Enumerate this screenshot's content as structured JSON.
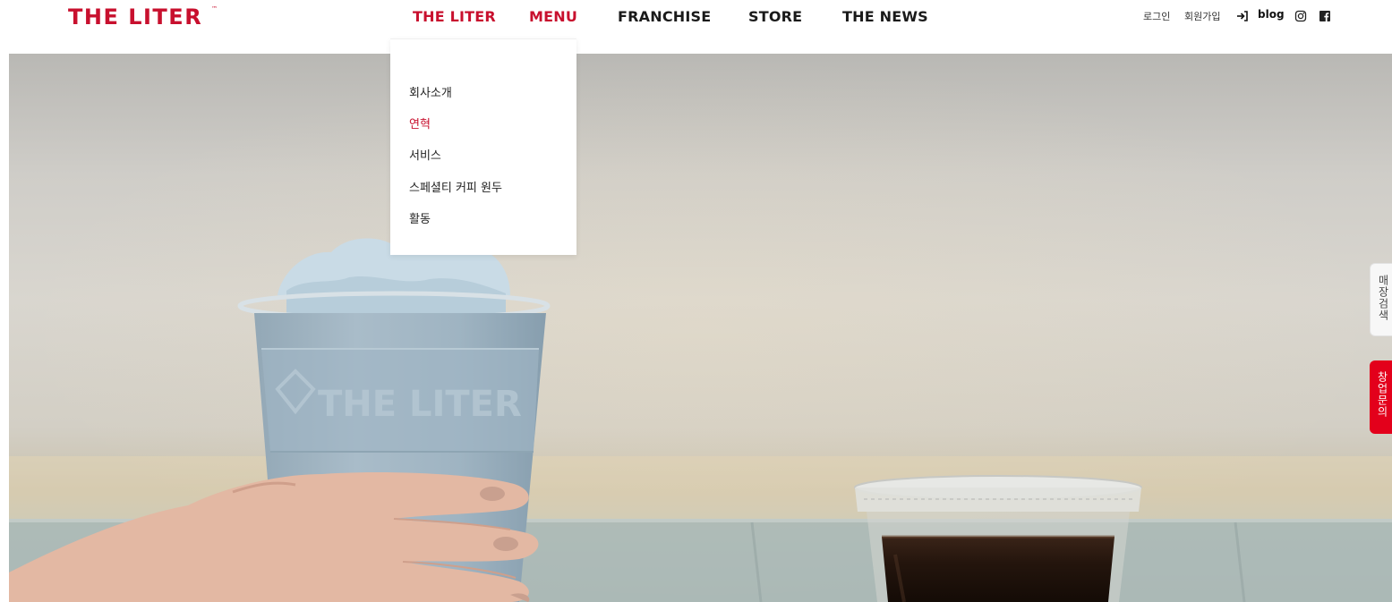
{
  "brand": {
    "logo_text": "THE LITER",
    "trademark": "™",
    "color_primary": "#c8102e"
  },
  "nav": {
    "items": [
      {
        "label": "THE LITER",
        "active": true
      },
      {
        "label": "MENU",
        "active": true
      },
      {
        "label": "FRANCHISE",
        "active": false
      },
      {
        "label": "STORE",
        "active": false
      },
      {
        "label": "THE NEWS",
        "active": false
      }
    ]
  },
  "utility": {
    "login": "로그인",
    "signup": "회원가입",
    "login_icon": "sign-in-icon",
    "blog": "blog",
    "instagram_icon": "instagram-icon",
    "facebook_icon": "facebook-icon"
  },
  "dropdown": {
    "items": [
      {
        "label": "회사소개",
        "active": false
      },
      {
        "label": "연혁",
        "active": true
      },
      {
        "label": "서비스",
        "active": false
      },
      {
        "label": "스페셜티 커피 원두",
        "active": false
      },
      {
        "label": "활동",
        "active": false
      }
    ]
  },
  "side_tabs": {
    "store_search": "매장검색",
    "franchise_inquiry": "창업문의",
    "franchise_color": "#e3001b"
  },
  "hero": {
    "cup_brand_text": "THE LITER"
  }
}
